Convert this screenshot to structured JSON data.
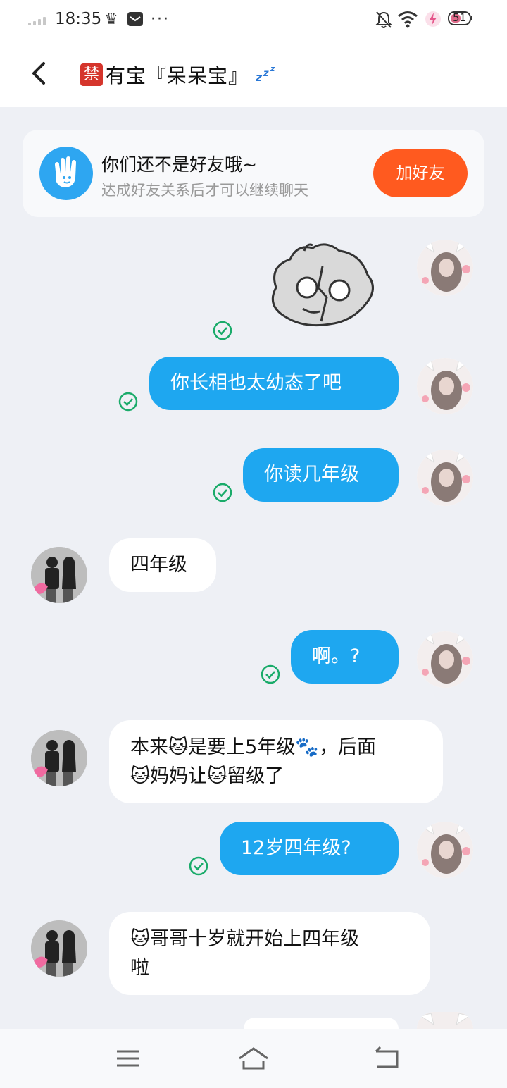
{
  "status_bar": {
    "time": "18:35",
    "battery_level": "51",
    "icons": [
      "signal-icon",
      "crown-icon",
      "message-icon",
      "more-icon",
      "mute-bell-icon",
      "wifi-icon",
      "charging-icon",
      "battery-icon"
    ]
  },
  "header": {
    "badge": "禁",
    "title": "有宝『呆呆宝』",
    "status_icon": "zzz-icon"
  },
  "friend_banner": {
    "title": "你们还不是好友哦~",
    "subtitle": "达成好友关系后才可以继续聊天",
    "button": "加好友"
  },
  "messages": [
    {
      "from": "me",
      "type": "sticker",
      "read": true
    },
    {
      "from": "me",
      "text": "你长相也太幼态了吧",
      "read": true
    },
    {
      "from": "me",
      "text": "你读几年级",
      "read": true
    },
    {
      "from": "other",
      "text": "四年级"
    },
    {
      "from": "me",
      "text": "啊。?",
      "read": true
    },
    {
      "from": "other",
      "lines": [
        "本来🐱是要上5年级🐾，后面",
        "🐱妈妈让🐱留级了"
      ]
    },
    {
      "from": "me",
      "text": "12岁四年级?",
      "read": true
    },
    {
      "from": "other",
      "lines": [
        "🐱哥哥十岁就开始上四年级",
        "啦"
      ]
    }
  ],
  "nav_bar": {
    "items": [
      "menu-icon",
      "home-icon",
      "back-nav-icon"
    ]
  },
  "colors": {
    "accent": "#1ea7f0",
    "add_button": "#ff5a1f",
    "read_check": "#1aab6a",
    "background": "#eef0f5"
  }
}
